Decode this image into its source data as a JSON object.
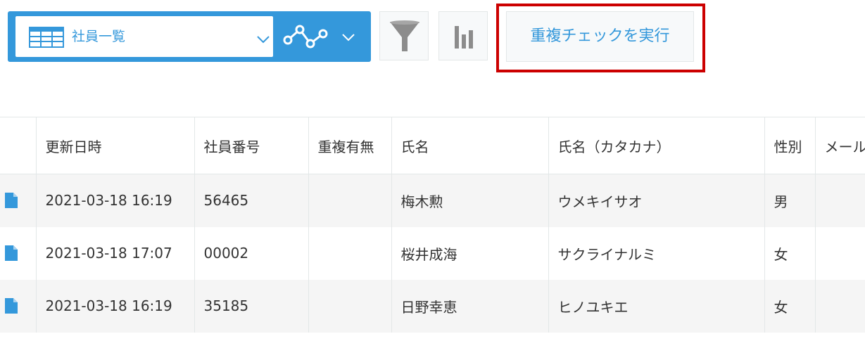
{
  "toolbar": {
    "view_name": "社員一覧",
    "accent_color": "#3498db",
    "duplicate_check_label": "重複チェックを実行",
    "highlight_color": "#cc0000"
  },
  "table": {
    "headers": {
      "updated_at": "更新日時",
      "employee_no": "社員番号",
      "duplicate": "重複有無",
      "name": "氏名",
      "name_kana": "氏名（カタカナ）",
      "gender": "性別",
      "email": "メール"
    },
    "rows": [
      {
        "updated_at": "2021-03-18 16:19",
        "employee_no": "56465",
        "duplicate": "",
        "name": "梅木勲",
        "name_kana": "ウメキイサオ",
        "gender": "男",
        "email": ""
      },
      {
        "updated_at": "2021-03-18 17:07",
        "employee_no": "00002",
        "duplicate": "",
        "name": "桜井成海",
        "name_kana": "サクライナルミ",
        "gender": "女",
        "email": ""
      },
      {
        "updated_at": "2021-03-18 16:19",
        "employee_no": "35185",
        "duplicate": "",
        "name": "日野幸恵",
        "name_kana": "ヒノユキエ",
        "gender": "女",
        "email": ""
      }
    ]
  }
}
